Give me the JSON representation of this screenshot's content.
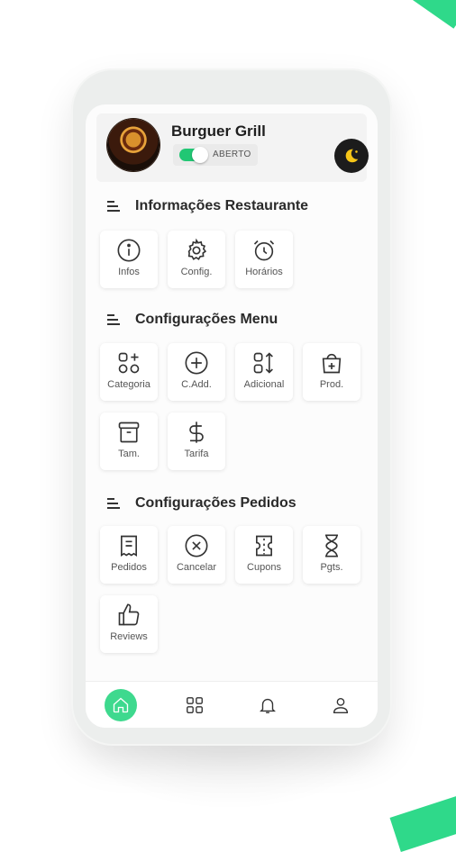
{
  "restaurant": {
    "name": "Burguer Grill",
    "status_label": "ABERTO",
    "is_open": true
  },
  "colors": {
    "accent": "#21c774",
    "nav_active": "#3ed98e",
    "theme_button": "#1c1c1c",
    "moon": "#f5c518"
  },
  "sections": {
    "info": {
      "title": "Informações Restaurante",
      "items": [
        {
          "label": "Infos",
          "icon": "info-icon"
        },
        {
          "label": "Config.",
          "icon": "gear-icon"
        },
        {
          "label": "Horários",
          "icon": "alarm-clock-icon"
        }
      ]
    },
    "menu": {
      "title": "Configurações Menu",
      "items": [
        {
          "label": "Categoria",
          "icon": "category-add-icon"
        },
        {
          "label": "C.Add.",
          "icon": "plus-circle-icon"
        },
        {
          "label": "Adicional",
          "icon": "sort-icon"
        },
        {
          "label": "Prod.",
          "icon": "bag-add-icon"
        },
        {
          "label": "Tam.",
          "icon": "archive-icon"
        },
        {
          "label": "Tarifa",
          "icon": "dollar-icon"
        }
      ]
    },
    "orders": {
      "title": "Configurações Pedidos",
      "items": [
        {
          "label": "Pedidos",
          "icon": "receipt-icon"
        },
        {
          "label": "Cancelar",
          "icon": "cancel-circle-icon"
        },
        {
          "label": "Cupons",
          "icon": "coupon-icon"
        },
        {
          "label": "Pgts.",
          "icon": "hourglass-icon"
        },
        {
          "label": "Reviews",
          "icon": "thumbs-up-icon"
        }
      ]
    }
  },
  "bottom_nav": {
    "items": [
      {
        "icon": "home-icon",
        "active": true
      },
      {
        "icon": "grid-icon",
        "active": false
      },
      {
        "icon": "bell-icon",
        "active": false
      },
      {
        "icon": "user-icon",
        "active": false
      }
    ]
  }
}
